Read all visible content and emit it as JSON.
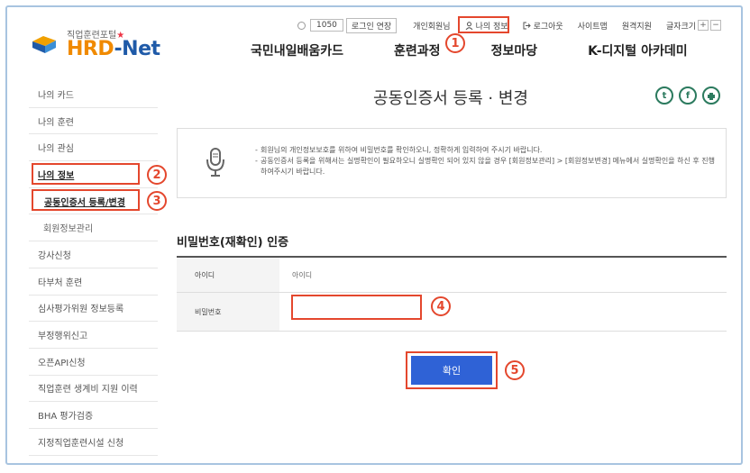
{
  "header": {
    "logo_sub": "직업훈련포털",
    "logo_name_hrd": "HRD",
    "logo_name_net": "-Net",
    "timer": "1050",
    "extend_login": "로그인 연장",
    "user_greeting": "개인회원님",
    "my_info": "나의 정보",
    "logout": "로그아웃",
    "sitemap": "사이트맵",
    "remote_support": "원격지원",
    "font_size": "글자크기",
    "zoom_in": "+",
    "zoom_out": "−"
  },
  "gnb": [
    "국민내일배움카드",
    "훈련과정",
    "정보마당",
    "K-디지털 아카데미"
  ],
  "sidebar": {
    "items": [
      "나의 카드",
      "나의 훈련",
      "나의 관심",
      "나의 정보",
      "공동인증서 등록/변경",
      "회원정보관리",
      "강사신청",
      "타부처 훈련",
      "심사평가위원 정보등록",
      "부정행위신고",
      "오픈API신청",
      "직업훈련 생계비 지원 이력",
      "BHA 평가검증",
      "지정직업훈련시설 신청"
    ]
  },
  "main": {
    "title": "공동인증서 등록 · 변경",
    "notice": [
      "회원님의 개인정보보호를 위하여 비밀번호를 확인하오니, 정확하게 입력하여 주시기 바랍니다.",
      "공동인증서 등록을 위해서는 실명확인이 필요하오니 실명확인 되어 있지 않을 경우 [회원정보관리] > [회원정보변경] 메뉴에서 실명확인을 하신 후 진행하여주시기 바랍니다."
    ],
    "section_title": "비밀번호(재확인) 인증",
    "id_label": "아이디",
    "id_value": "아이디",
    "pw_label": "비밀번호",
    "pw_value": "",
    "confirm": "확인"
  },
  "annotations": [
    "1",
    "2",
    "3",
    "4",
    "5"
  ],
  "share_icons": [
    "twitter-icon",
    "facebook-icon",
    "print-icon"
  ],
  "colors": {
    "highlight": "#e4472d",
    "primary_button": "#2f62d6",
    "share": "#2b7a5e",
    "logo_blue": "#1f5aa8",
    "logo_orange": "#f08a00"
  }
}
